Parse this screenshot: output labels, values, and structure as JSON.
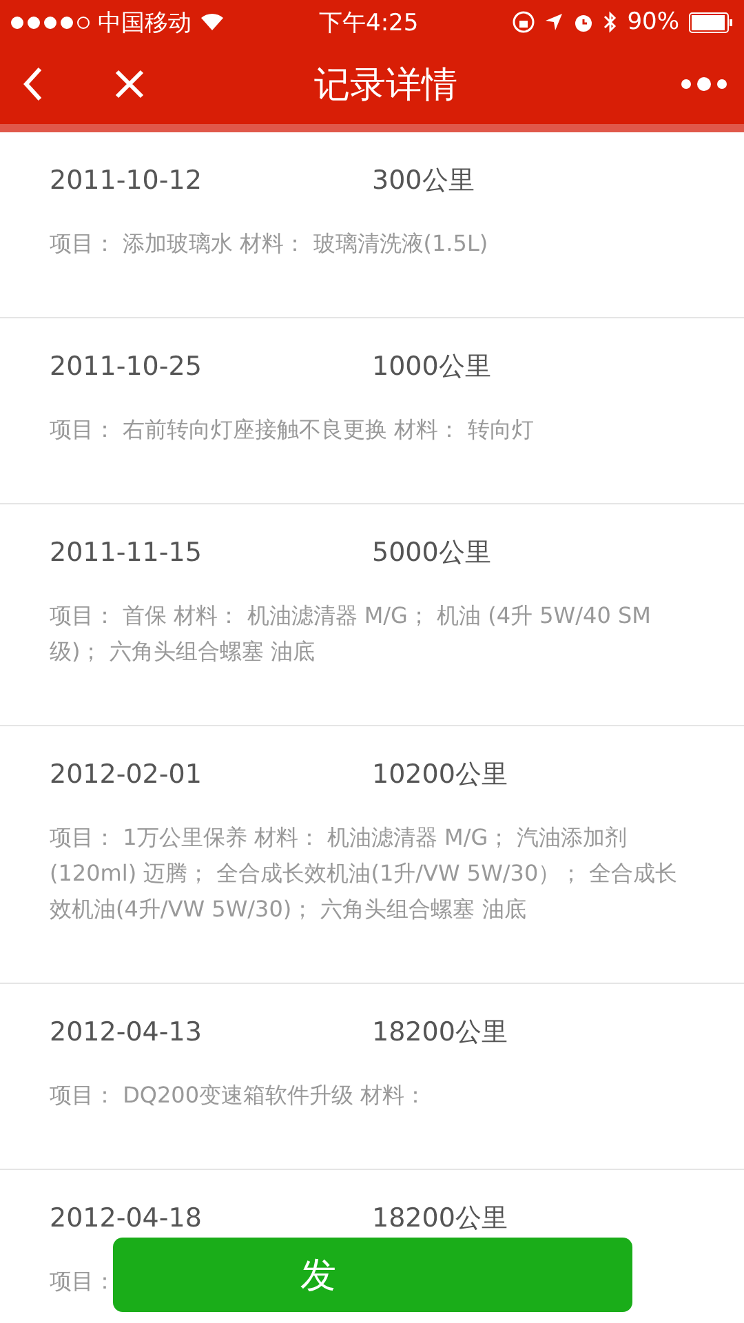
{
  "status_bar": {
    "carrier": "中国移动",
    "time": "下午4:25",
    "battery": "90%"
  },
  "nav": {
    "title": "记录详情"
  },
  "records": [
    {
      "date": "2011-10-12",
      "mileage": "300公里",
      "detail": "项目：  添加玻璃水 材料：  玻璃清洗液(1.5L)"
    },
    {
      "date": "2011-10-25",
      "mileage": "1000公里",
      "detail": "项目：  右前转向灯座接触不良更换 材料：  转向灯"
    },
    {
      "date": "2011-11-15",
      "mileage": "5000公里",
      "detail": "项目：  首保 材料：  机油滤清器 M/G；  机油 (4升 5W/40 SM级)；  六角头组合螺塞 油底"
    },
    {
      "date": "2012-02-01",
      "mileage": "10200公里",
      "detail": "项目：  1万公里保养 材料：  机油滤清器 M/G；  汽油添加剂(120ml) 迈腾；  全合成长效机油(1升/VW 5W/30）；  全合成长效机油(4升/VW 5W/30)；  六角头组合螺塞 油底"
    },
    {
      "date": "2012-04-13",
      "mileage": "18200公里",
      "detail": "项目：  DQ200变速箱软件升级 材料："
    },
    {
      "date": "2012-04-18",
      "mileage": "18200公里",
      "detail": "项目："
    }
  ],
  "action_button": {
    "label": "发"
  }
}
